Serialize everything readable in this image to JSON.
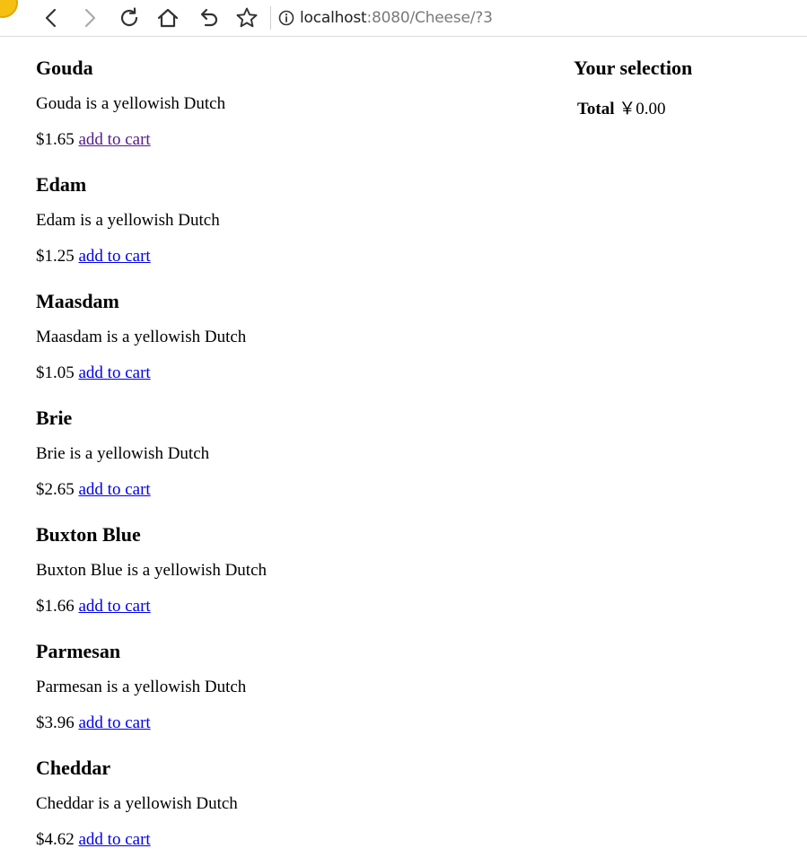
{
  "browser": {
    "address": {
      "host": "localhost",
      "rest": ":8080/Cheese/?3"
    }
  },
  "link_colors": {
    "unvisited": "#0000ee",
    "visited": "#551a8b"
  },
  "products": [
    {
      "name": "Gouda",
      "description": "Gouda is a yellowish Dutch",
      "price": "$1.65",
      "link": "add to cart"
    },
    {
      "name": "Edam",
      "description": "Edam is a yellowish Dutch",
      "price": "$1.25",
      "link": "add to cart"
    },
    {
      "name": "Maasdam",
      "description": "Maasdam is a yellowish Dutch",
      "price": "$1.05",
      "link": "add to cart"
    },
    {
      "name": "Brie",
      "description": "Brie is a yellowish Dutch",
      "price": "$2.65",
      "link": "add to cart"
    },
    {
      "name": "Buxton Blue",
      "description": "Buxton Blue is a yellowish Dutch",
      "price": "$1.66",
      "link": "add to cart"
    },
    {
      "name": "Parmesan",
      "description": "Parmesan is a yellowish Dutch",
      "price": "$3.96",
      "link": "add to cart"
    },
    {
      "name": "Cheddar",
      "description": "Cheddar is a yellowish Dutch",
      "price": "$4.62",
      "link": "add to cart"
    }
  ],
  "selection": {
    "title": "Your selection",
    "total_label": "Total",
    "total_value": "￥0.00"
  }
}
